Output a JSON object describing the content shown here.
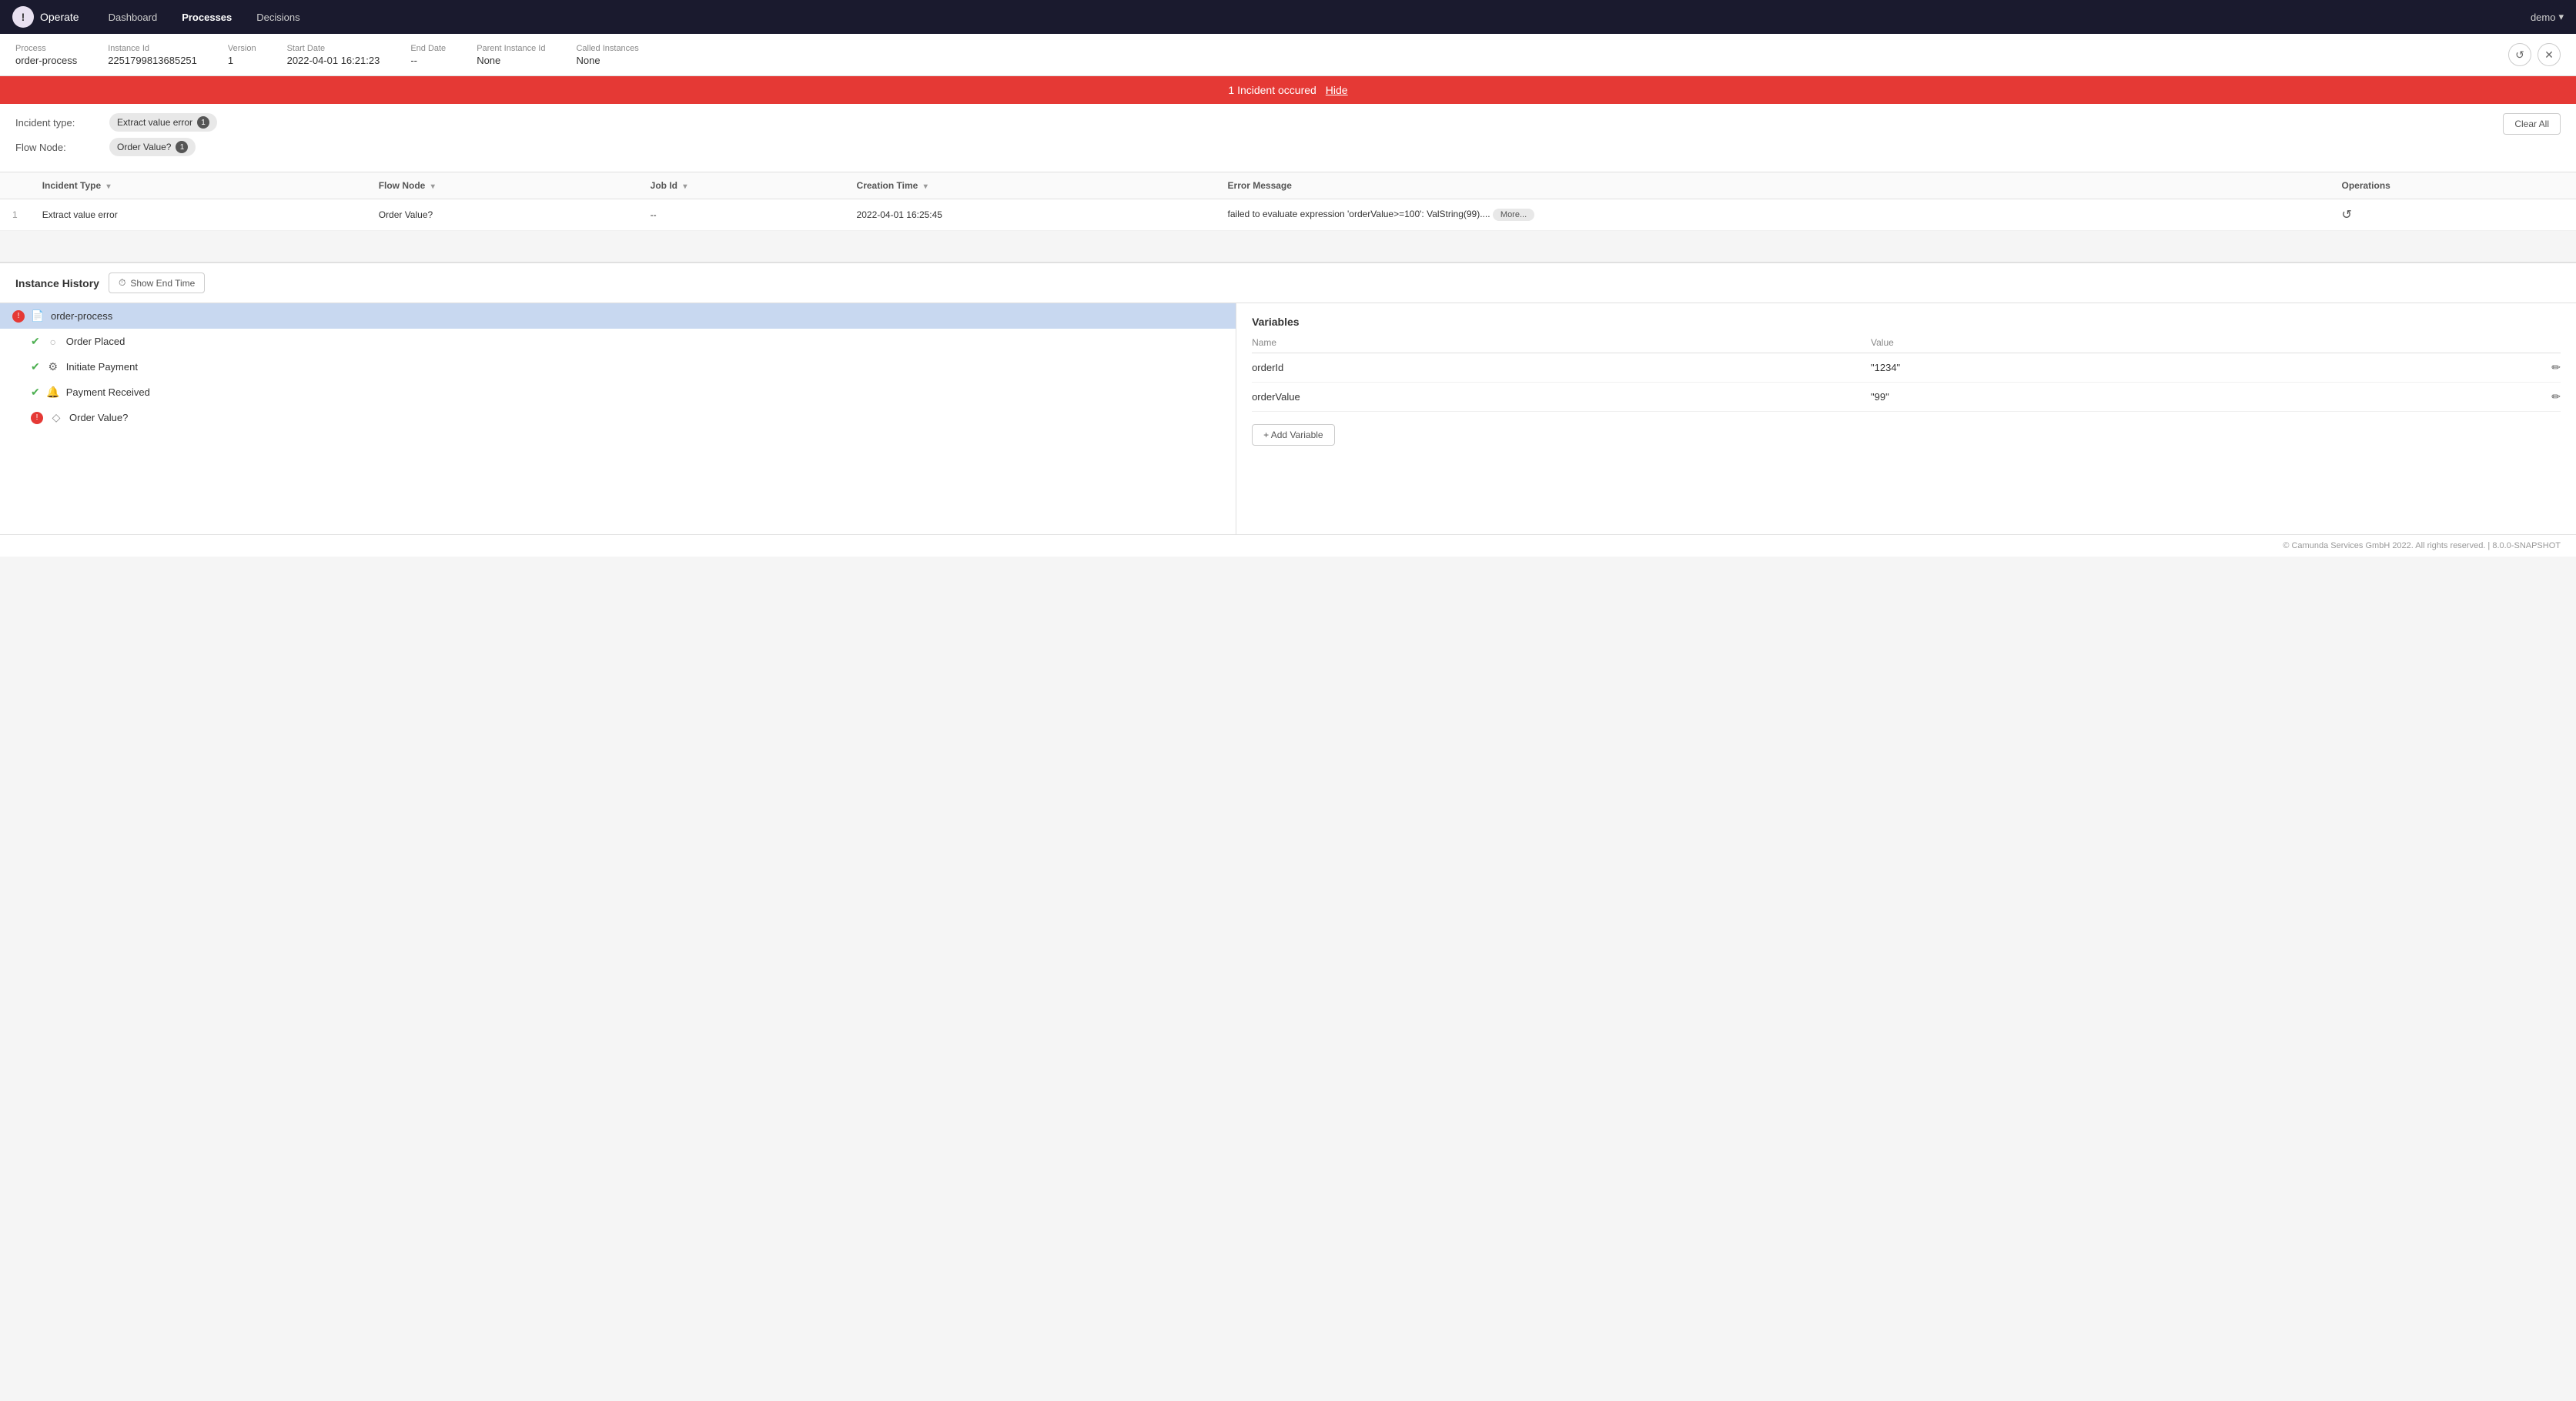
{
  "nav": {
    "logo_icon": "!",
    "app_name": "Operate",
    "links": [
      {
        "label": "Dashboard",
        "active": false
      },
      {
        "label": "Processes",
        "active": true
      },
      {
        "label": "Decisions",
        "active": false
      }
    ],
    "user": "demo"
  },
  "process_header": {
    "process_label": "Process",
    "process_value": "order-process",
    "instance_id_label": "Instance Id",
    "instance_id_value": "2251799813685251",
    "version_label": "Version",
    "version_value": "1",
    "start_date_label": "Start Date",
    "start_date_value": "2022-04-01 16:21:23",
    "end_date_label": "End Date",
    "end_date_value": "--",
    "parent_instance_label": "Parent Instance Id",
    "parent_instance_value": "None",
    "called_instances_label": "Called Instances",
    "called_instances_value": "None"
  },
  "incident_banner": {
    "message": "1 Incident occured",
    "hide_label": "Hide"
  },
  "filters": {
    "incident_type_label": "Incident type:",
    "incident_type_tag": "Extract value error",
    "incident_type_count": "1",
    "flow_node_label": "Flow Node:",
    "flow_node_tag": "Order Value?",
    "flow_node_count": "1",
    "clear_all_label": "Clear All"
  },
  "incidents_table": {
    "columns": [
      {
        "label": "Incident Type",
        "sortable": true
      },
      {
        "label": "Flow Node",
        "sortable": true
      },
      {
        "label": "Job Id",
        "sortable": true
      },
      {
        "label": "Creation Time",
        "sortable": true
      },
      {
        "label": "Error Message",
        "sortable": false
      },
      {
        "label": "Operations",
        "sortable": false
      }
    ],
    "rows": [
      {
        "num": "1",
        "incident_type": "Extract value error",
        "flow_node": "Order Value?",
        "job_id": "--",
        "creation_time": "2022-04-01 16:25:45",
        "error_message": "failed to evaluate expression 'orderValue>=100': ValString(99)....",
        "more_label": "More..."
      }
    ]
  },
  "instance_history": {
    "title": "Instance History",
    "show_end_time_label": "Show End Time",
    "items": [
      {
        "name": "order-process",
        "type": "process",
        "selected": true,
        "error": true,
        "indent": 0
      },
      {
        "name": "Order Placed",
        "type": "event",
        "selected": false,
        "error": false,
        "indent": 1,
        "completed": true
      },
      {
        "name": "Initiate Payment",
        "type": "service",
        "selected": false,
        "error": false,
        "indent": 1,
        "completed": true
      },
      {
        "name": "Payment Received",
        "type": "message",
        "selected": false,
        "error": false,
        "indent": 1,
        "completed": true
      },
      {
        "name": "Order Value?",
        "type": "gateway",
        "selected": false,
        "error": true,
        "indent": 1,
        "completed": false
      }
    ]
  },
  "variables": {
    "title": "Variables",
    "name_col": "Name",
    "value_col": "Value",
    "items": [
      {
        "name": "orderId",
        "value": "\"1234\""
      },
      {
        "name": "orderValue",
        "value": "\"99\""
      }
    ],
    "add_variable_label": "+ Add Variable"
  },
  "footer": {
    "text": "© Camunda Services GmbH 2022. All rights reserved. | 8.0.0-SNAPSHOT"
  }
}
